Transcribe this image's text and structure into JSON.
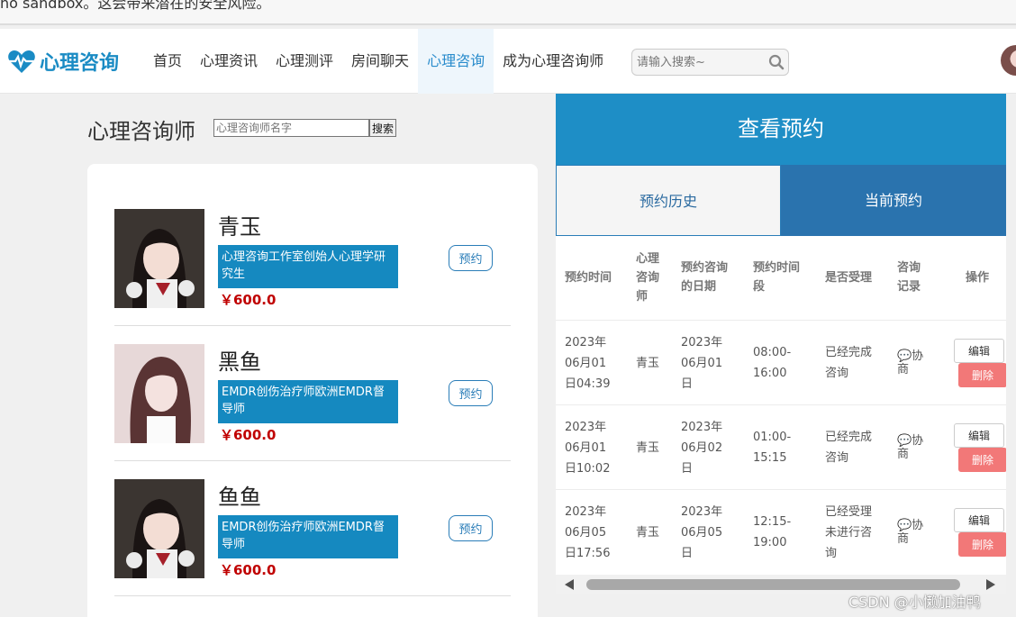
{
  "top_strip": {
    "text": "no sandbox。这会带来潜在的安全风险。"
  },
  "brand": {
    "name": "心理咨询",
    "color": "#1a8bc4"
  },
  "nav": {
    "items": [
      {
        "label": "首页"
      },
      {
        "label": "心理资讯"
      },
      {
        "label": "心理测评"
      },
      {
        "label": "房间聊天"
      },
      {
        "label": "心理咨询",
        "active": true
      },
      {
        "label": "成为心理咨询师"
      }
    ],
    "search_placeholder": "请输入搜索~"
  },
  "counselors_section": {
    "title": "心理咨询师",
    "name_placeholder": "心理咨询师名字",
    "search_label": "搜索",
    "items": [
      {
        "name": "青玉",
        "description": "心理咨询工作室创始人心理学研究生",
        "price": "￥600.0",
        "book_label": "预约",
        "photo": "anime-girl-avatar"
      },
      {
        "name": "黑鱼",
        "description": "EMDR创伤治疗师欧洲EMDR督导师",
        "price": "￥600.0",
        "book_label": "预约",
        "photo": "woman-portrait-avatar"
      },
      {
        "name": "鱼鱼",
        "description": "EMDR创伤治疗师欧洲EMDR督导师",
        "price": "￥600.0",
        "book_label": "预约",
        "photo": "anime-girl-avatar"
      }
    ]
  },
  "appointments": {
    "header": "查看预约",
    "tabs": [
      {
        "label": "预约历史"
      },
      {
        "label": "当前预约",
        "active": true
      }
    ],
    "columns": [
      "预约时间",
      "心理咨询师",
      "预约咨询的日期",
      "预约时间段",
      "是否受理",
      "咨询记录",
      "操作"
    ],
    "rows": [
      {
        "booked_at": "2023年06月01日04:39",
        "counselor": "青玉",
        "date": "2023年06月01日",
        "slot": "08:00-16:00",
        "status": "已经完成咨询",
        "record": "💬协商",
        "edit": "编辑",
        "delete": "删除"
      },
      {
        "booked_at": "2023年06月01日10:02",
        "counselor": "青玉",
        "date": "2023年06月02日",
        "slot": "01:00-15:15",
        "status": "已经完成咨询",
        "record": "💬协商",
        "edit": "编辑",
        "delete": "删除"
      },
      {
        "booked_at": "2023年06月05日17:56",
        "counselor": "青玉",
        "date": "2023年06月05日",
        "slot": "12:15-19:00",
        "status": "已经受理未进行咨询",
        "record": "💬协商",
        "edit": "编辑",
        "delete": "删除"
      }
    ]
  },
  "watermark": "CSDN @小懒加油鸭",
  "colors": {
    "header_blue": "#1e8ec6",
    "active_tab": "#2a73ae",
    "price_red": "#c00000",
    "delete_red": "#f27878"
  }
}
